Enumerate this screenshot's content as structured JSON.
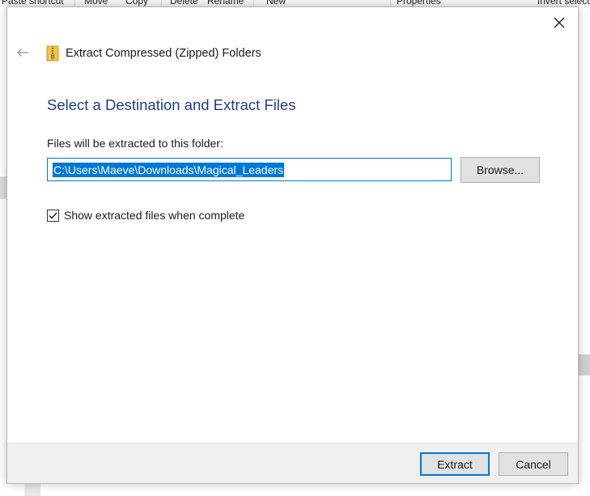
{
  "background": {
    "ribbon_items": [
      "Paste shortcut",
      "Move",
      "Copy",
      "Delete",
      "Rename",
      "New",
      "Properties",
      "Invert selection"
    ]
  },
  "dialog": {
    "title": "Extract Compressed (Zipped) Folders",
    "heading": "Select a Destination and Extract Files",
    "destination_label": "Files will be extracted to this folder:",
    "destination_value": "C:\\Users\\Maeve\\Downloads\\Magical_Leaders",
    "browse_label": "Browse...",
    "show_files_label": "Show extracted files when complete",
    "show_files_checked": true,
    "extract_label": "Extract",
    "cancel_label": "Cancel"
  },
  "icons": {
    "close": "close-icon",
    "back": "back-arrow-icon",
    "zip": "zip-folder-icon",
    "check": "checkmark-icon"
  },
  "colors": {
    "heading": "#1e3c8c",
    "accent": "#0078d7",
    "button_face": "#e1e1e1",
    "footer": "#f0f0f0"
  }
}
